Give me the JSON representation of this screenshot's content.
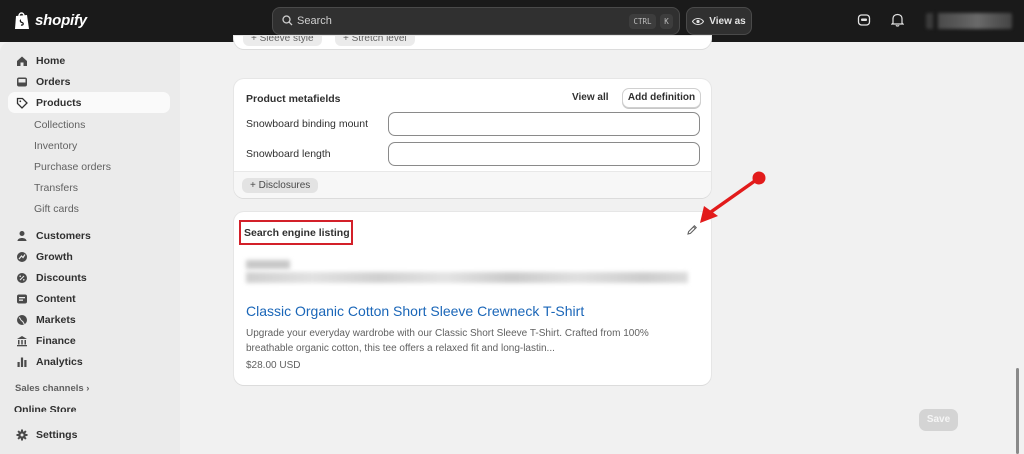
{
  "header": {
    "brand": "shopify",
    "search_placeholder": "Search",
    "kbd_ctrl": "CTRL",
    "kbd_k": "K",
    "view_as": "View as"
  },
  "sidebar": {
    "items": [
      {
        "label": "Home"
      },
      {
        "label": "Orders"
      },
      {
        "label": "Products"
      },
      {
        "label": "Customers"
      },
      {
        "label": "Growth"
      },
      {
        "label": "Discounts"
      },
      {
        "label": "Content"
      },
      {
        "label": "Markets"
      },
      {
        "label": "Finance"
      },
      {
        "label": "Analytics"
      }
    ],
    "sub_items": [
      {
        "label": "Collections"
      },
      {
        "label": "Inventory"
      },
      {
        "label": "Purchase orders"
      },
      {
        "label": "Transfers"
      },
      {
        "label": "Gift cards"
      }
    ],
    "sales_channels": "Sales channels",
    "online_store": "Online Store",
    "settings": "Settings"
  },
  "top_chips": {
    "first": "+ Sleeve style",
    "second": "+ Stretch level"
  },
  "metafields": {
    "title": "Product metafields",
    "view_all": "View all",
    "add_definition": "Add definition",
    "fields": [
      {
        "label": "Snowboard binding mount",
        "value": ""
      },
      {
        "label": "Snowboard length",
        "value": ""
      }
    ],
    "disclosures": "+ Disclosures"
  },
  "seo": {
    "title": "Search engine listing",
    "link": "Classic Organic Cotton Short Sleeve Crewneck T-Shirt",
    "description": "Upgrade your everyday wardrobe with our Classic Short Sleeve T-Shirt. Crafted from 100% breathable organic cotton, this tee offers a relaxed fit and long-lastin...",
    "price": "$28.00 USD"
  },
  "footer": {
    "save": "Save"
  },
  "colors": {
    "topbar": "#1a1a1a",
    "link": "#1a66b8",
    "highlight": "#d32029"
  }
}
